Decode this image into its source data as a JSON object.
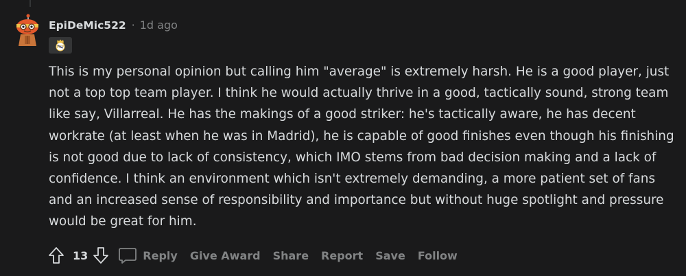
{
  "comment": {
    "username": "EpiDeMic522",
    "separator": "·",
    "timestamp": "1d ago",
    "flair_icon": "real-madrid-crest-icon",
    "body": "This is my personal opinion but calling him \"average\" is extremely harsh. He is a good player, just not a top top team player. I think he would actually thrive in a good, tactically sound, strong team like say, Villarreal. He has the makings of a good striker: he's tactically aware, he has decent workrate (at least when he was in Madrid), he is capable of good finishes even though his finishing is not good due to lack of consistency, which IMO stems from bad decision making and a lack of confidence. I think an environment which isn't extremely demanding, a more patient set of fans and an increased sense of responsibility and importance but without huge spotlight and pressure would be great for him.",
    "score": "13",
    "actions": {
      "reply": "Reply",
      "give_award": "Give Award",
      "share": "Share",
      "report": "Report",
      "save": "Save",
      "follow": "Follow"
    }
  },
  "colors": {
    "background": "#1a1a1b",
    "text": "#d7dadc",
    "muted": "#818384",
    "avatar_orange": "#e3582b"
  }
}
